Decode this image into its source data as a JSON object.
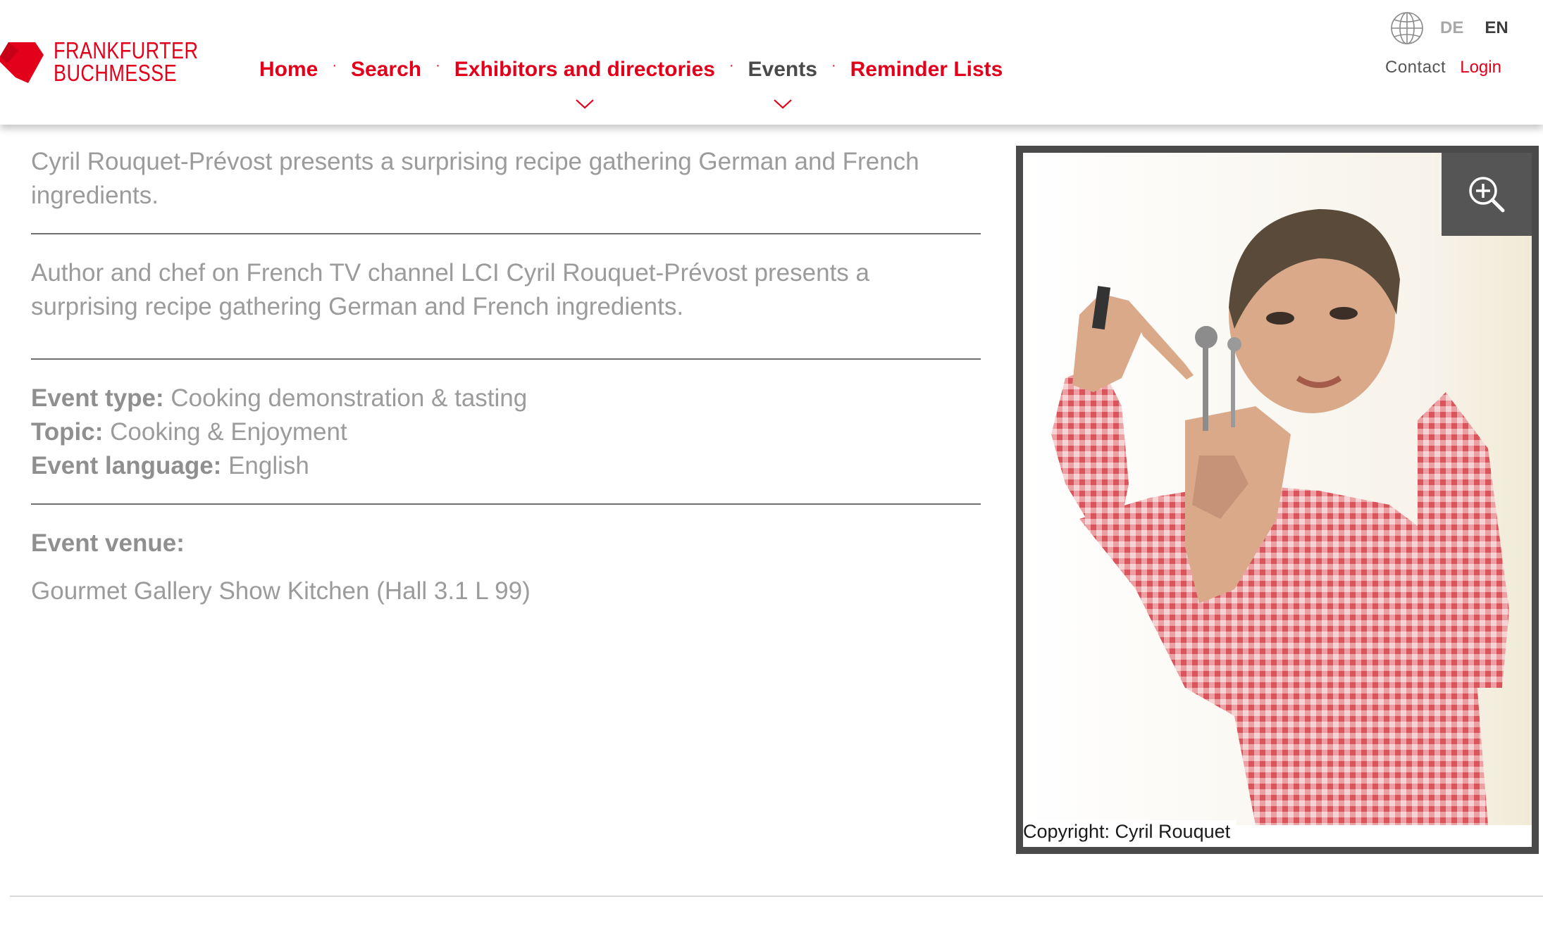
{
  "header": {
    "logo": {
      "line1": "FRANKFURTER",
      "line2": "BUCHMESSE",
      "icon": "book-mark-icon"
    },
    "nav": [
      {
        "label": "Home",
        "has_dropdown": false,
        "active": false
      },
      {
        "label": "Search",
        "has_dropdown": false,
        "active": false
      },
      {
        "label": "Exhibitors and directories",
        "has_dropdown": true,
        "active": false
      },
      {
        "label": "Events",
        "has_dropdown": true,
        "active": true
      },
      {
        "label": "Reminder Lists",
        "has_dropdown": false,
        "active": false
      }
    ],
    "nav_separator": "·",
    "language": {
      "icon": "globe-icon",
      "options": [
        "DE",
        "EN"
      ],
      "selected": "EN"
    },
    "utility": {
      "contact": "Contact",
      "login": "Login"
    }
  },
  "event": {
    "summary": "Cyril Rouquet-Prévost presents a surprising recipe gathering German and French ingredients.",
    "description": "Author and chef on French TV channel LCI Cyril Rouquet-Prévost presents a surprising recipe gathering German and French ingredients.",
    "details": [
      {
        "label": "Event type:",
        "value": "Cooking demonstration & tasting"
      },
      {
        "label": "Topic:",
        "value": "Cooking & Enjoyment"
      },
      {
        "label": "Event language:",
        "value": "English"
      }
    ],
    "venue_label": "Event venue:",
    "venue": "Gourmet Gallery Show Kitchen (Hall 3.1 L 99)"
  },
  "figure": {
    "zoom_icon": "zoom-in-icon",
    "caption": "Copyright: Cyril Rouquet"
  },
  "colors": {
    "brand_red": "#e3001b",
    "text_gray": "#9b9b9b",
    "nav_active": "#4a4a4a",
    "frame": "#4a4a4a"
  }
}
